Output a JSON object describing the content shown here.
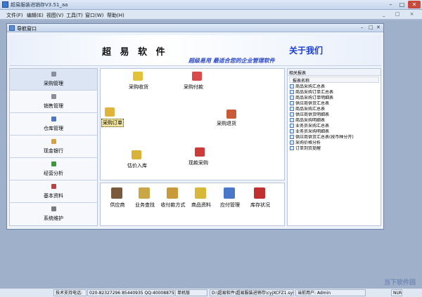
{
  "window": {
    "title": "超易服装进销存V3.51_aa"
  },
  "menu": [
    "文件(F)",
    "编辑(E)",
    "视图(V)",
    "工具(T)",
    "窗口(W)",
    "帮助(H)"
  ],
  "nav_window": {
    "title": "导航窗口"
  },
  "banner": {
    "brand": "超 易 软 件",
    "about": "关于我们",
    "slogan": "超级易用  最适合您的企业管理软件"
  },
  "sidebar": [
    {
      "label": "采购管理",
      "icon": "purchase-icon",
      "color": "#8a8f9e"
    },
    {
      "label": "销售管理",
      "icon": "sales-icon",
      "color": "#8a8f9e"
    },
    {
      "label": "仓库管理",
      "icon": "warehouse-icon",
      "color": "#4a78c8"
    },
    {
      "label": "现金银行",
      "icon": "cash-icon",
      "color": "#d8a13a"
    },
    {
      "label": "经营分析",
      "icon": "analysis-icon",
      "color": "#3a9a3a"
    },
    {
      "label": "基本资料",
      "icon": "basic-data-icon",
      "color": "#c04040"
    },
    {
      "label": "系统维护",
      "icon": "maintenance-icon",
      "color": "#7a7a7a"
    }
  ],
  "workflow": [
    {
      "label": "采购收货",
      "icon": "receive-goods-icon",
      "color": "#e3c23a"
    },
    {
      "label": "采购付款",
      "icon": "payment-icon",
      "color": "#d94a4a"
    },
    {
      "label": "采购订单",
      "icon": "purchase-order-icon",
      "color": "#e0b43a"
    },
    {
      "label": "采购退货",
      "icon": "return-goods-icon",
      "color": "#c85a3a"
    },
    {
      "label": "估价入库",
      "icon": "valuation-storage-icon",
      "color": "#d9b23a"
    },
    {
      "label": "现款采购",
      "icon": "cash-purchase-icon",
      "color": "#cc3a3a"
    }
  ],
  "shortcuts": [
    {
      "label": "供应商",
      "icon": "supplier-icon",
      "color": "#7a5a3a"
    },
    {
      "label": "业务查找",
      "icon": "search-business-icon",
      "color": "#c9a646"
    },
    {
      "label": "收付款方式",
      "icon": "payment-method-icon",
      "color": "#c99a3a"
    },
    {
      "label": "商品资料",
      "icon": "goods-data-icon",
      "color": "#d8b83a"
    },
    {
      "label": "应付管理",
      "icon": "payable-icon",
      "color": "#4a78c8"
    },
    {
      "label": "库存状况",
      "icon": "stock-status-icon",
      "color": "#c03030"
    }
  ],
  "reports": {
    "title": "相关报表",
    "header": "报表名称",
    "items": [
      "商品采购汇总表",
      "商品采购订单汇总表",
      "商品采购订单明细表",
      "供应商供货汇总表",
      "商品采购汇总表",
      "供应商供货明细表",
      "商品采购明细表",
      "业务员采购汇总表",
      "业务员采购明细表",
      "供应商供货汇总表(按币种分开)",
      "采购价格分析",
      "订单到货提醒"
    ]
  },
  "status": {
    "support": "技术支持电话:",
    "phones": "020-82327296 85440935 QQ:400088750 1966903",
    "edition": "单机版",
    "path": "D:\\超易软件\\超易服装进销存\\cyjXCFZ1.sys",
    "user": "当前用户: Admin",
    "num": "NUM"
  },
  "watermark": "当下软件园"
}
